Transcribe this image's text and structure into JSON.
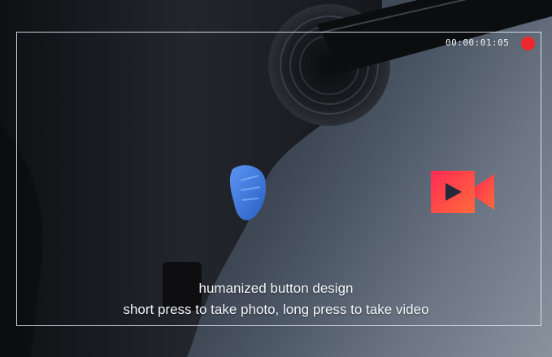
{
  "recording": {
    "timer": "00:00:01:05",
    "dot_color": "#f0282c"
  },
  "overlay": {
    "icon": "video-camera-icon",
    "icon_gradient": [
      "#ff2a55",
      "#ff6a3a"
    ]
  },
  "caption": {
    "line1": "humanized button design",
    "line2": "short press to take photo, long press to take video"
  },
  "colors": {
    "button_accent": "#3a78e0"
  }
}
